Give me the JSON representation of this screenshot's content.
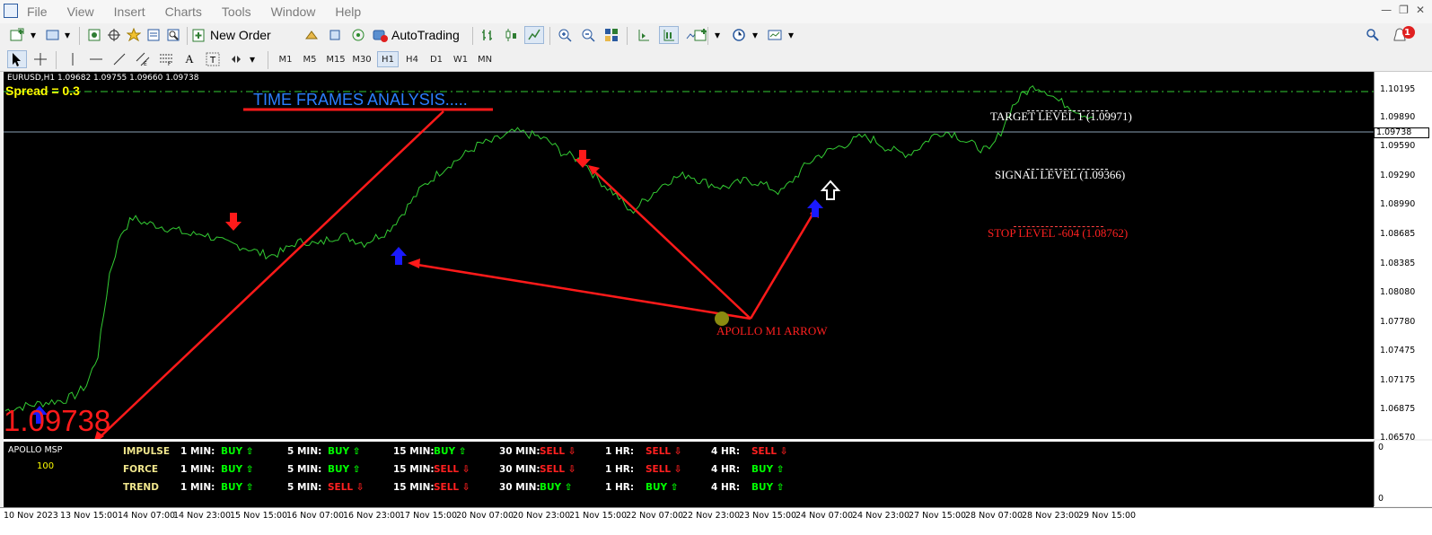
{
  "menu": {
    "items": [
      "File",
      "View",
      "Insert",
      "Charts",
      "Tools",
      "Window",
      "Help"
    ]
  },
  "toolbar": {
    "new_order_label": "New Order",
    "autotrading_label": "AutoTrading",
    "timeframes": [
      "M1",
      "M5",
      "M15",
      "M30",
      "H1",
      "H4",
      "D1",
      "W1",
      "MN"
    ],
    "selected_timeframe": "H1",
    "notification_count": "1"
  },
  "chart": {
    "symbol_info": "EURUSD,H1  1.09682 1.09755 1.09660 1.09738",
    "spread_text": "Spread = 0.3",
    "title_text": "TIME FRAMES ANALYSIS.....",
    "target_text": "TARGET LEVEL 1 (1.09971)",
    "signal_text": "SIGNAL LEVEL (1.09366)",
    "stop_text": "STOP LEVEL -604 (1.08762)",
    "apollo_arrow_text": "APOLLO M1 ARROW",
    "big_price": "1.09738",
    "current_price_box": "1.09738",
    "price_ticks": [
      "1.10195",
      "1.09890",
      "1.09590",
      "1.09290",
      "1.08990",
      "1.08685",
      "1.08385",
      "1.08080",
      "1.07780",
      "1.07475",
      "1.07175",
      "1.06875",
      "1.06570"
    ],
    "colors": {
      "price_line": "#33cc33",
      "arrows": "#ff1a1a",
      "buy_arrow": "#0000ff"
    }
  },
  "indicator": {
    "name": "APOLLO MSP",
    "value": "100",
    "axis_top": "0",
    "axis_bottom": "0",
    "rows": [
      {
        "name": "IMPULSE",
        "cells": [
          {
            "tf": "1 MIN:",
            "signal": "BUY",
            "dir": "buy"
          },
          {
            "tf": "5 MIN:",
            "signal": "BUY",
            "dir": "buy"
          },
          {
            "tf": "15 MIN:",
            "signal": "BUY",
            "dir": "buy"
          },
          {
            "tf": "30 MIN:",
            "signal": "SELL",
            "dir": "sell"
          },
          {
            "tf": "1 HR:",
            "signal": "SELL",
            "dir": "sell"
          },
          {
            "tf": "4 HR:",
            "signal": "SELL",
            "dir": "sell"
          }
        ]
      },
      {
        "name": "FORCE",
        "cells": [
          {
            "tf": "1 MIN:",
            "signal": "BUY",
            "dir": "buy"
          },
          {
            "tf": "5 MIN:",
            "signal": "BUY",
            "dir": "buy"
          },
          {
            "tf": "15 MIN:",
            "signal": "SELL",
            "dir": "sell"
          },
          {
            "tf": "30 MIN:",
            "signal": "SELL",
            "dir": "sell"
          },
          {
            "tf": "1 HR:",
            "signal": "SELL",
            "dir": "sell"
          },
          {
            "tf": "4 HR:",
            "signal": "BUY",
            "dir": "buy"
          }
        ]
      },
      {
        "name": "TREND",
        "cells": [
          {
            "tf": "1 MIN:",
            "signal": "BUY",
            "dir": "buy"
          },
          {
            "tf": "5 MIN:",
            "signal": "SELL",
            "dir": "sell"
          },
          {
            "tf": "15 MIN:",
            "signal": "SELL",
            "dir": "sell"
          },
          {
            "tf": "30 MIN:",
            "signal": "BUY",
            "dir": "buy"
          },
          {
            "tf": "1 HR:",
            "signal": "BUY",
            "dir": "buy"
          },
          {
            "tf": "4 HR:",
            "signal": "BUY",
            "dir": "buy"
          }
        ]
      }
    ]
  },
  "time_ticks": [
    "10 Nov 2023",
    "13 Nov 15:00",
    "14 Nov 07:00",
    "14 Nov 23:00",
    "15 Nov 15:00",
    "16 Nov 07:00",
    "16 Nov 23:00",
    "17 Nov 15:00",
    "20 Nov 07:00",
    "20 Nov 23:00",
    "21 Nov 15:00",
    "22 Nov 07:00",
    "22 Nov 23:00",
    "23 Nov 15:00",
    "24 Nov 07:00",
    "24 Nov 23:00",
    "27 Nov 15:00",
    "28 Nov 07:00",
    "28 Nov 23:00",
    "29 Nov 15:00"
  ],
  "chart_data": {
    "type": "line",
    "title": "",
    "xlabel": "",
    "ylabel": "",
    "ylim": [
      1.0657,
      1.1019
    ],
    "series": [
      {
        "values": [
          1.0685,
          1.0688,
          1.069,
          1.0692,
          1.0694,
          1.0695,
          1.07,
          1.071,
          1.074,
          1.082,
          1.086,
          1.0875,
          1.087,
          1.0868,
          1.0865,
          1.0862,
          1.0858,
          1.086,
          1.0855,
          1.085,
          1.0848,
          1.0845,
          1.084,
          1.0838,
          1.0842,
          1.085,
          1.0852,
          1.0848,
          1.0855,
          1.0858,
          1.0854,
          1.085,
          1.0856,
          1.0862,
          1.0875,
          1.089,
          1.0905,
          1.0915,
          1.0925,
          1.0932,
          1.094,
          1.0948,
          1.095,
          1.0955,
          1.096,
          1.0958,
          1.0955,
          1.095,
          1.094,
          1.0935,
          1.093,
          1.0915,
          1.0905,
          1.0895,
          1.088,
          1.089,
          1.09,
          1.091,
          1.0915,
          1.0918,
          1.0912,
          1.0908,
          1.0905,
          1.0908,
          1.0912,
          1.091,
          1.0905,
          1.09,
          1.0912,
          1.0925,
          1.0935,
          1.094,
          1.0945,
          1.095,
          1.0955,
          1.0952,
          1.0945,
          1.094,
          1.0938,
          1.0945,
          1.0955,
          1.096,
          1.0958,
          1.095,
          1.0945,
          1.094,
          1.096,
          1.0985,
          1.0998,
          1.1005,
          1.1,
          1.099,
          1.0985,
          1.0978,
          1.0974
        ]
      }
    ]
  }
}
